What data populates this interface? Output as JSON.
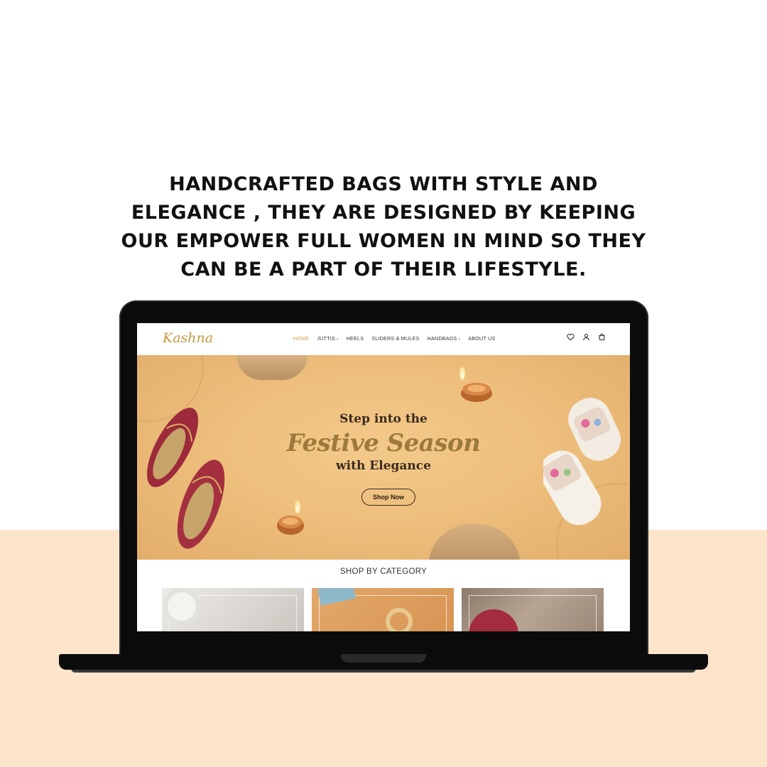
{
  "headline": {
    "lines": [
      "HANDCRAFTED BAGS WITH STYLE AND",
      "ELEGANCE , THEY ARE DESIGNED BY KEEPING",
      "OUR EMPOWER FULL WOMEN IN MIND SO THEY",
      "CAN BE A PART OF THEIR LIFESTYLE."
    ]
  },
  "site": {
    "logo": "Kashna",
    "nav": [
      {
        "label": "HOME",
        "active": true,
        "dropdown": false
      },
      {
        "label": "JUTTIS",
        "active": false,
        "dropdown": true
      },
      {
        "label": "HEELS",
        "active": false,
        "dropdown": false
      },
      {
        "label": "SLIDERS & MULES",
        "active": false,
        "dropdown": false
      },
      {
        "label": "HANDBAGS",
        "active": false,
        "dropdown": true
      },
      {
        "label": "ABOUT US",
        "active": false,
        "dropdown": false
      }
    ],
    "icons": [
      "heart-icon",
      "user-icon",
      "bag-icon"
    ],
    "hero": {
      "line1": "Step into the",
      "line2": "Festive Season",
      "line3": "with Elegance",
      "cta": "Shop Now"
    },
    "category_title": "SHOP BY CATEGORY",
    "categories": [
      "heels-category",
      "handbags-category",
      "juttis-category"
    ]
  },
  "colors": {
    "accent": "#d49b4a",
    "hero_bg": "#eebf7d",
    "bottom_band": "#fde5cc"
  }
}
